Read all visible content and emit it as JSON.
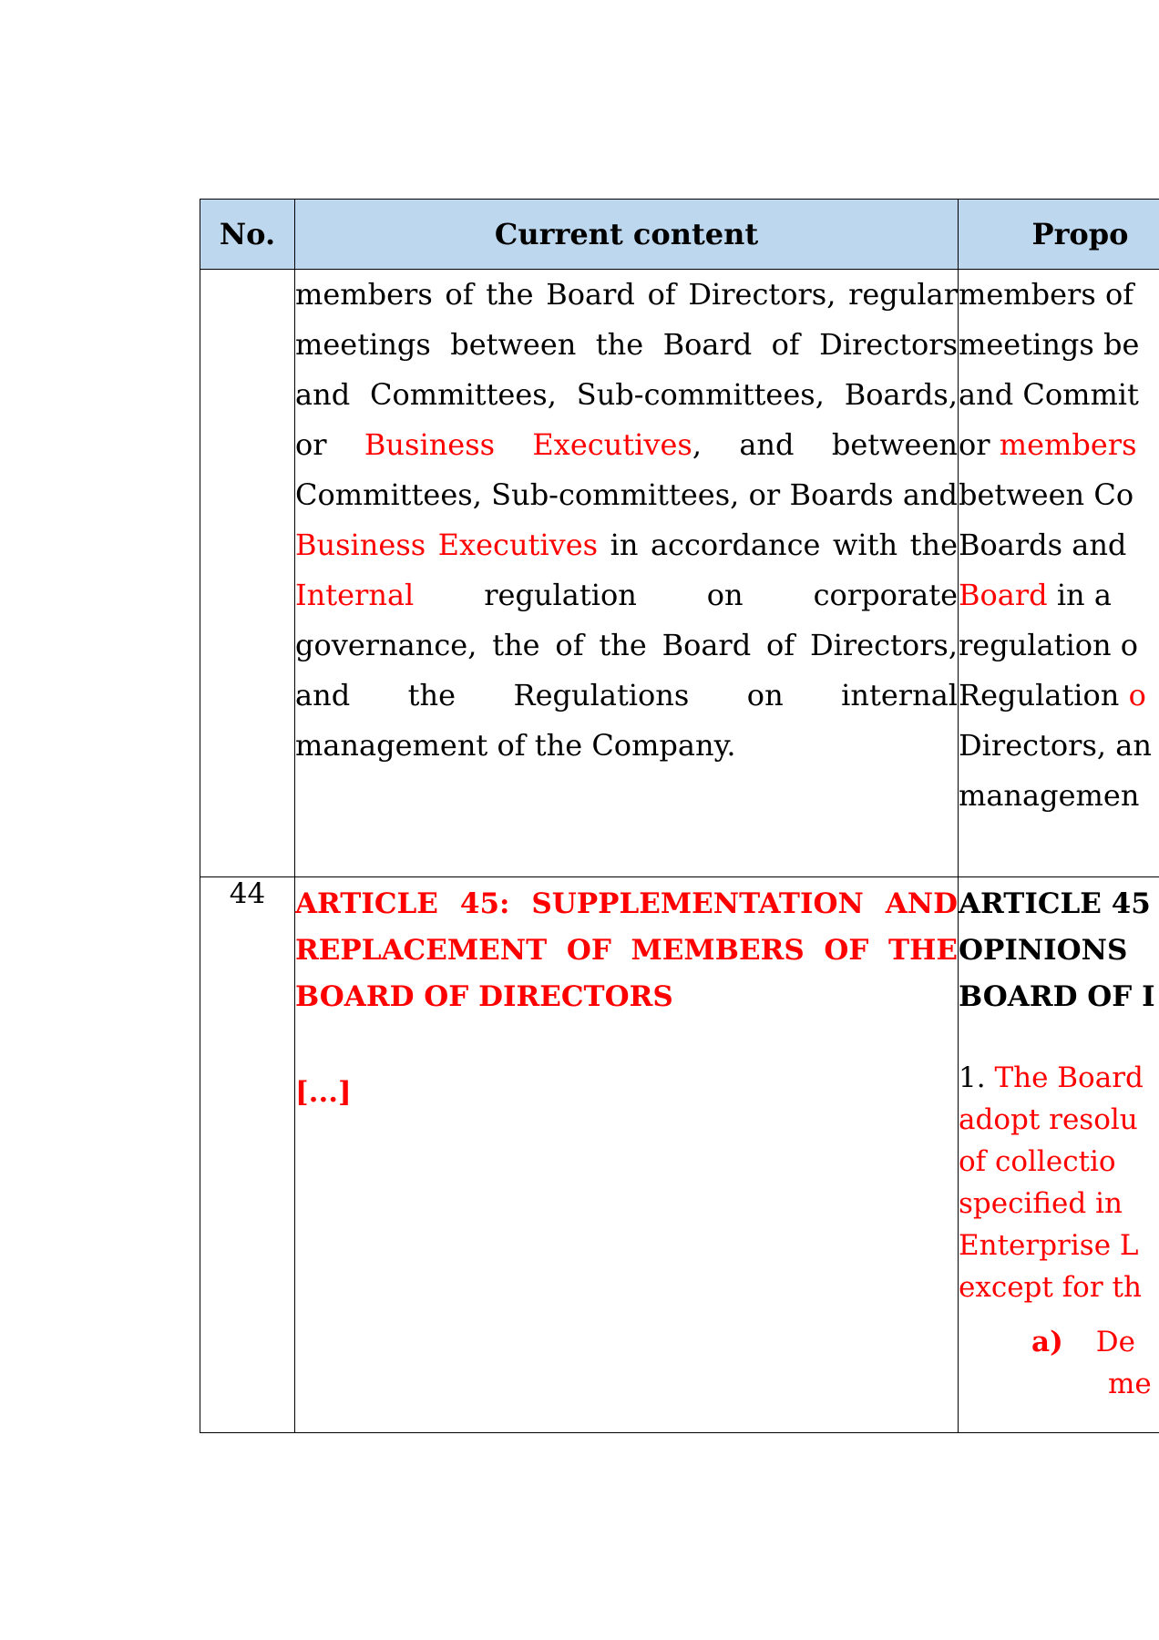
{
  "table": {
    "headers": {
      "no": "No.",
      "current": "Current content",
      "proposed": "Propo"
    },
    "row1": {
      "no": "",
      "current": {
        "t1": "members of the Board of Directors, regular meetings between the Board of Directors and Committees, Sub-committees, Boards, or ",
        "r1": "Business Executives",
        "t2": ", and between Committees, Sub-committees, or Boards and ",
        "r2": "Business Executives",
        "t3": " in accordance with the ",
        "r3": "Internal",
        "t4": " regulation on corporate governance, the of the Board of Directors, and the Regulations on internal management of the Company."
      },
      "proposed": {
        "l1": "members of",
        "l2": "meetings be",
        "l3": "and Commit",
        "l4a": "or ",
        "l4b": "members",
        "l5": "between Co",
        "l6": "Boards and",
        "l7a": "Board",
        "l7b": " in a",
        "l8": "regulation o",
        "l9a": "Regulation ",
        "l9b": "o",
        "l10": "Directors, an",
        "l11": "managemen"
      }
    },
    "row2": {
      "no": "44",
      "current": {
        "title": "ARTICLE 45: SUPPLEMENTATION AND REPLACEMENT OF MEMBERS OF THE BOARD OF DIRECTORS",
        "ellipsis": "[...]"
      },
      "proposed": {
        "title1": "ARTICLE 45",
        "title2": "OPINIONS",
        "title3": "BOARD OF I",
        "p_num": "1. ",
        "p1": "The Board",
        "p2": "adopt resolu",
        "p3": "of collectio",
        "p4": "specified in",
        "p5": "Enterprise L",
        "p6": "except for th",
        "a_label": "a)",
        "a1": "De",
        "a2": "me"
      }
    }
  }
}
